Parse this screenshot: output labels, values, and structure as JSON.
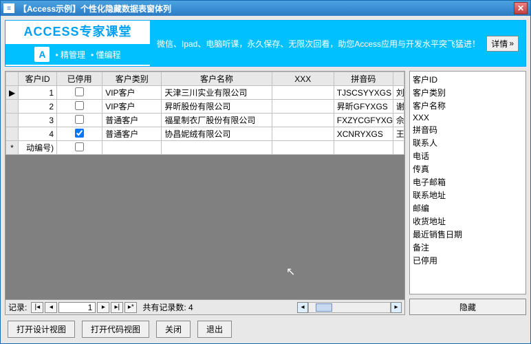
{
  "titlebar": {
    "icon": "≡",
    "title": "【Access示例】个性化隐藏数据表窗体列"
  },
  "banner": {
    "title": "ACCESS专家课堂",
    "sub1": "精管理",
    "sub2": "懂编程",
    "promo": "微信、Ipad、电脑听课，永久保存、无限次回看，助您Access应用与开发水平突飞猛进！",
    "detail": "详情"
  },
  "grid": {
    "headers": [
      "客户ID",
      "已停用",
      "客户类别",
      "客户名称",
      "XXX",
      "拼音码"
    ],
    "rows": [
      {
        "sel": "▶",
        "id": "1",
        "stopped": false,
        "cat": "VIP客户",
        "name": "天津三川实业有限公司",
        "xxx": "",
        "py": "TJSCSYYXGS",
        "tail": "刘"
      },
      {
        "sel": "",
        "id": "2",
        "stopped": false,
        "cat": "VIP客户",
        "name": "昇昕股份有限公司",
        "xxx": "",
        "py": "昇昕GFYXGS",
        "tail": "谢"
      },
      {
        "sel": "",
        "id": "3",
        "stopped": false,
        "cat": "普通客户",
        "name": "福星制衣厂股份有限公司",
        "xxx": "",
        "py": "FXZYCGFYXG",
        "tail": "佘"
      },
      {
        "sel": "",
        "id": "4",
        "stopped": true,
        "cat": "普通客户",
        "name": "协昌妮绒有限公司",
        "xxx": "",
        "py": "XCNRYXGS",
        "tail": "王"
      },
      {
        "sel": "*",
        "id": "动编号)",
        "stopped": false,
        "cat": "",
        "name": "",
        "xxx": "",
        "py": "",
        "tail": ""
      }
    ]
  },
  "recordnav": {
    "label": "记录:",
    "value": "1",
    "count_label": "共有记录数:",
    "count": "4"
  },
  "fieldlist": [
    "客户ID",
    "客户类别",
    "客户名称",
    "XXX",
    "拼音码",
    "联系人",
    "电话",
    "传真",
    "电子邮箱",
    "联系地址",
    "邮编",
    "收货地址",
    "最近销售日期",
    "备注",
    "已停用"
  ],
  "buttons": {
    "hide": "隐藏",
    "designview": "打开设计视图",
    "codeview": "打开代码视图",
    "close": "关闭",
    "exit": "退出"
  }
}
